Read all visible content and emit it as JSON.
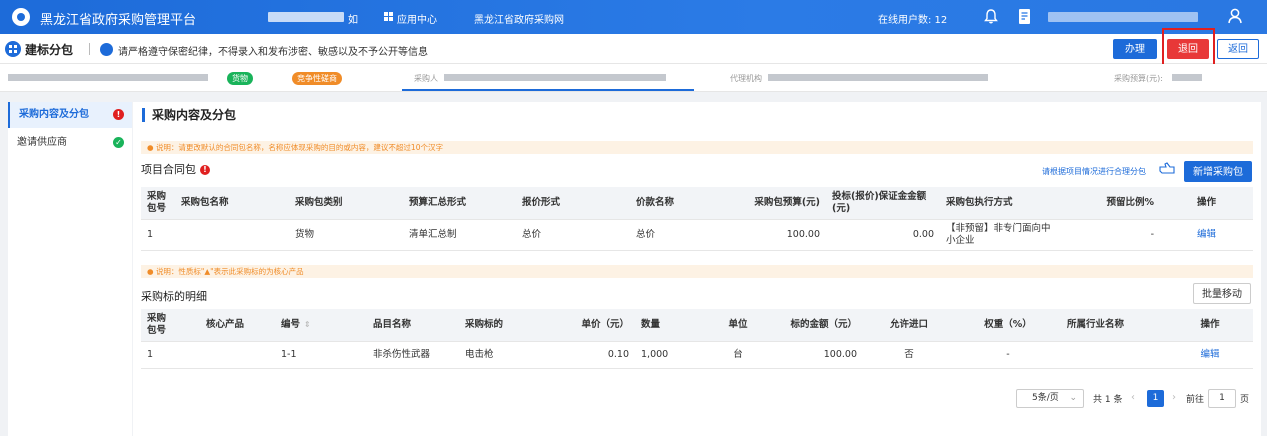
{
  "header": {
    "app_title": "黑龙江省政府采购管理平台",
    "nav_app_center": "应用中心",
    "nav_portal": "黑龙江省政府采购网",
    "online_users": "在线用户数: 12"
  },
  "subheader": {
    "title": "建标分包",
    "notice": "请严格遵守保密纪律，不得录入和发布涉密、敏感以及不予公开等信息",
    "btn_handle": "办理",
    "btn_return": "退回",
    "btn_back": "返回"
  },
  "inforow": {
    "tag_goods": "货物",
    "tag_method": "竞争性磋商",
    "label_buyer": "采购人",
    "label_agency": "代理机构",
    "label_budget": "采购预算(元):"
  },
  "sidebar": {
    "items": [
      {
        "label": "采购内容及分包",
        "status": "warning"
      },
      {
        "label": "邀请供应商",
        "status": "done"
      }
    ]
  },
  "main": {
    "section_title": "采购内容及分包",
    "tip1": "说明：请更改默认的合同包名称，名称应体现采购的目的或内容，建议不超过10个汉字",
    "packages_title": "项目合同包",
    "packages_hint": "请根据项目情况进行合理分包",
    "btn_add_package": "新增采购包",
    "packages_table": {
      "headers": [
        "采购包号",
        "采购包名称",
        "采购包类别",
        "预算汇总形式",
        "报价形式",
        "价款名称",
        "采购包预算(元)",
        "投标(报价)保证金金额(元)",
        "采购包执行方式",
        "预留比例%",
        "操作"
      ],
      "rows": [
        [
          "1",
          "",
          "货物",
          "清单汇总制",
          "总价",
          "总价",
          "100.00",
          "0.00",
          "【非预留】非专门面向中小企业",
          "-",
          "编辑"
        ]
      ]
    },
    "tip2": "说明：性质标\"▲\"表示此采购标的为核心产品",
    "items_title": "采购标的明细",
    "btn_batch_move": "批量移动",
    "items_table": {
      "headers": [
        "采购包号",
        "核心产品",
        "编号",
        "品目名称",
        "采购标的",
        "单价（元）",
        "数量",
        "单位",
        "标的金额（元）",
        "允许进口",
        "权重（%）",
        "所属行业名称",
        "操作"
      ],
      "rows": [
        [
          "1",
          "",
          "1-1",
          "非杀伤性武器",
          "电击枪",
          "0.10",
          "1,000",
          "台",
          "100.00",
          "否",
          "-",
          "",
          "编辑"
        ]
      ]
    }
  },
  "pagination": {
    "page_size": "5条/页",
    "total": "共 1 条",
    "current": "1",
    "goto_label": "前往",
    "goto_value": "1",
    "page_suffix": "页"
  },
  "colors": {
    "primary": "#1d6bd9",
    "danger": "#e83838",
    "success": "#19b35a",
    "warning": "#f08c28"
  }
}
